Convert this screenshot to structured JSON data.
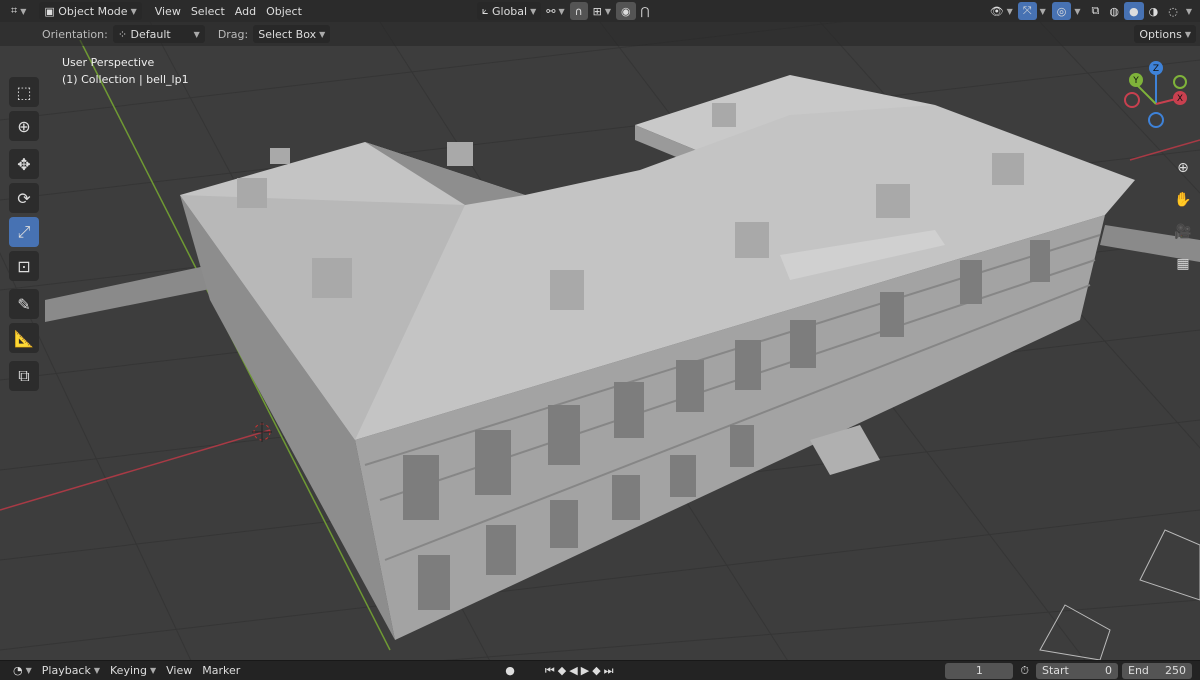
{
  "header": {
    "editor_icon": "viewport-editor-icon",
    "mode": "Object Mode",
    "menus": [
      "View",
      "Select",
      "Add",
      "Object"
    ],
    "orientation_global": "Global",
    "options": "Options"
  },
  "tool_header": {
    "orientation_label": "Orientation:",
    "orientation_value": "Default",
    "drag_label": "Drag:",
    "drag_value": "Select Box"
  },
  "viewport": {
    "perspective": "User Perspective",
    "collection": "(1) Collection | bell_lp1",
    "gizmo": {
      "x": "X",
      "y": "Y",
      "z": "Z"
    }
  },
  "toolbar": [
    "select-box",
    "cursor",
    "move",
    "rotate",
    "scale",
    "transform",
    "annotate",
    "measure",
    "add-cube"
  ],
  "timeline": {
    "menus": [
      "Playback",
      "Keying",
      "View",
      "Marker"
    ],
    "current_frame": "1",
    "start_label": "Start",
    "start": "0",
    "end_label": "End",
    "end": "250"
  },
  "colors": {
    "accent": "#4772b3",
    "x_axis": "#c8404f",
    "y_axis": "#7fb33a",
    "z_axis": "#3e82d8"
  }
}
